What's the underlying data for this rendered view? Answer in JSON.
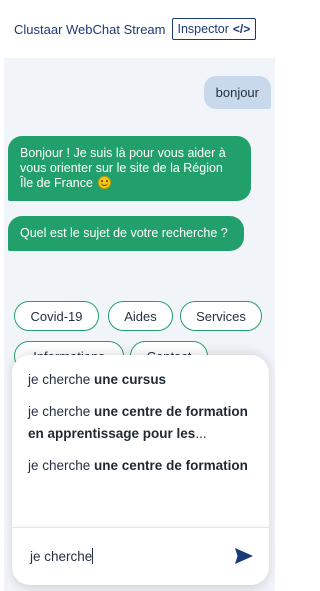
{
  "header": {
    "title": "Clustaar WebChat Stream",
    "inspector_label": "Inspector",
    "inspector_icon": "code-icon"
  },
  "messages": {
    "user_1": "bonjour",
    "bot_1": "Bonjour ! Je suis là pour vous aider à vous orienter sur le site de la Région Île de France",
    "bot_1_emoji": "smiling-face-icon",
    "bot_2": "Quel est le sujet de votre recherche ?"
  },
  "quick_replies": [
    "Covid-19",
    "Aides",
    "Services",
    "Informations",
    "Contact"
  ],
  "suggestions": [
    {
      "prefix": "je cherche ",
      "bold": "une cursus",
      "suffix": ""
    },
    {
      "prefix": "je cherche ",
      "bold": "une centre de formation en apprentissage pour les",
      "suffix": "..."
    },
    {
      "prefix": "je cherche ",
      "bold": "une centre de formation",
      "suffix": ""
    }
  ],
  "input": {
    "value": "je cherche",
    "send_icon": "send-icon"
  },
  "colors": {
    "brand_blue": "#1b3a78",
    "bot_green": "#22a06b",
    "user_bubble": "#c9d9ec",
    "chat_bg": "#f1f4f8"
  }
}
